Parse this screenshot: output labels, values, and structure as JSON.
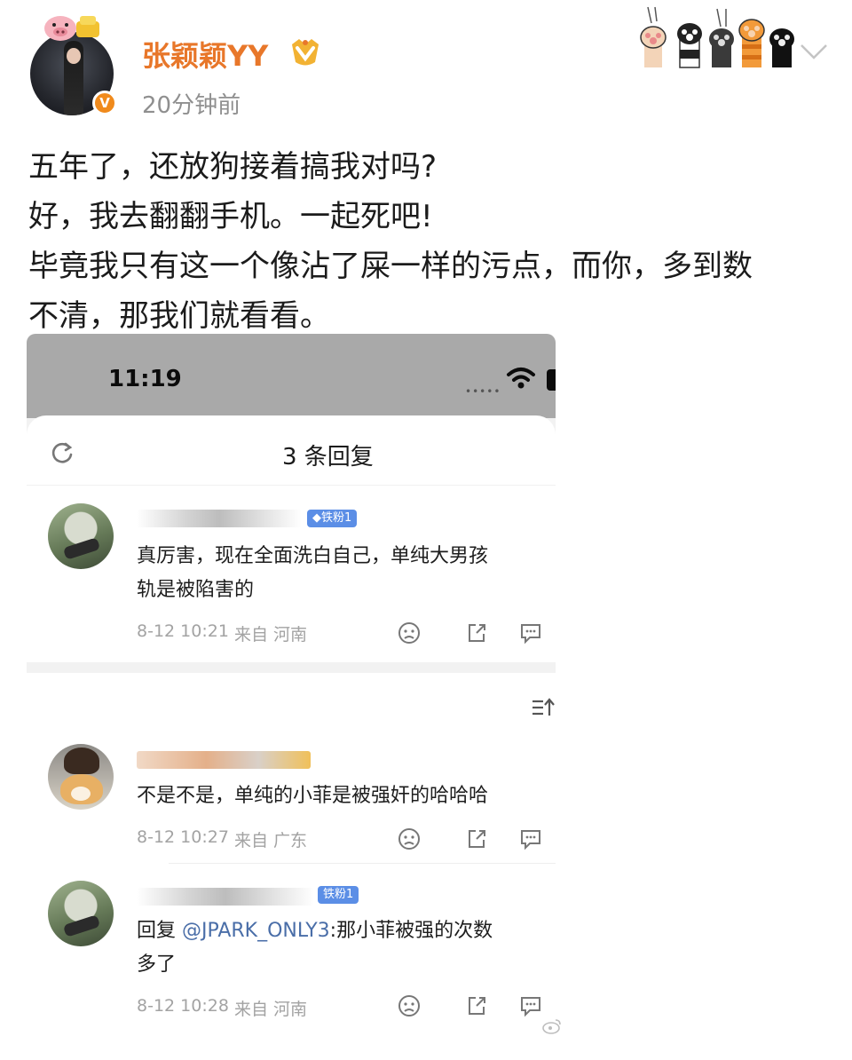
{
  "post": {
    "username": "张颖颖YY",
    "time_ago": "20分钟前",
    "verified_mark": "V",
    "lines": [
      "五年了，还放狗接着搞我对吗?",
      "好，我去翻翻手机。一起死吧!",
      "毕竟我只有这一个像沾了屎一样的污点，而你，多到数",
      "不清，那我们就看看。"
    ]
  },
  "screenshot": {
    "status_time": "11:19",
    "status_dots": "•••••",
    "sheet_title": "3 条回复",
    "comments": [
      {
        "badge": "◆铁粉1",
        "line1": "真厉害，现在全面洗白自己，单纯大男孩",
        "line2": "轨是被陷害的",
        "date": "8-12 10:21",
        "location": "来自 河南"
      },
      {
        "line1": "不是不是，单纯的小菲是被强奸的哈哈哈",
        "date": "8-12 10:27",
        "location": "来自 广东"
      },
      {
        "badge": "铁粉1",
        "reply_prefix": "回复 ",
        "mention": "@JPARK_ONLY3",
        "line1_rest": ":那小菲被强的次数",
        "line2": "多了",
        "date": "8-12 10:28",
        "location": "来自 河南"
      }
    ]
  },
  "icons": [
    "pig-badge-icon",
    "vip-badge-icon",
    "paw-prints-icon",
    "chevron-down-icon",
    "refresh-icon",
    "wifi-icon",
    "sad-face-icon",
    "share-icon",
    "comment-icon",
    "sort-icon",
    "weibo-watermark-icon"
  ],
  "colors": {
    "username": "#e8772a",
    "verified": "#f08a1c",
    "fan_badge": "#5b8ee6",
    "mention": "#4a6ea8"
  }
}
